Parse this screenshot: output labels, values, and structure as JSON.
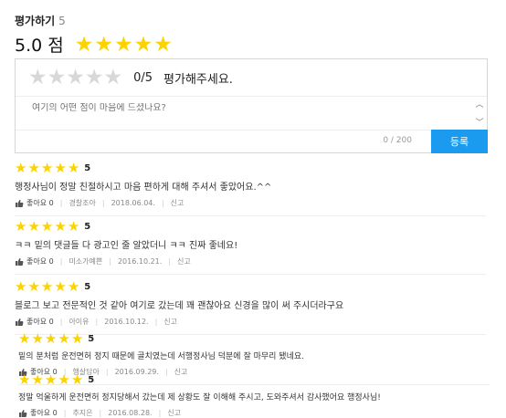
{
  "header": {
    "title": "평가하기",
    "count": "5"
  },
  "average": {
    "score": "5.0 점",
    "stars": 5
  },
  "form": {
    "rating_score": "0/5",
    "rating_prompt": "평가해주세요.",
    "input_placeholder": "여기의 어떤 점이 마음에 드셨나요?",
    "char_counter": "0 / 200",
    "submit_label": "등록"
  },
  "labels": {
    "like": "좋아요",
    "reply": "신고"
  },
  "reviews": [
    {
      "score": "5",
      "text": "행정사님이 정말 친절하시고 마음 편하게 대해 주셔서 좋았어요.^^",
      "likes": "0",
      "author": "경찰조아",
      "date": "2018.06.04."
    },
    {
      "score": "5",
      "text": "ㅋㅋ 밑의 댓글들 다 광고인 줄 알았더니 ㅋㅋ 진짜 좋네요!",
      "likes": "0",
      "author": "미소가예쁜",
      "date": "2016.10.21."
    },
    {
      "score": "5",
      "text": "블로그 보고 전문적인 것 같아 여기로 갔는데 꽤 괜찮아요 신경을 많이 써 주시더라구요",
      "likes": "0",
      "author": "아이유",
      "date": "2016.10.12."
    },
    {
      "score": "5",
      "text": "밑의 분처럼 운전면허 정지 때문에 골치였는데 서행정사님 덕분에 잘 마무리 됐네요.",
      "likes": "0",
      "author": "행살담아",
      "date": "2016.09.29."
    },
    {
      "score": "5",
      "text": "정말 억울하게 운전면허 정지당해서 갔는데 제 상황도 잘 이해해 주시고, 도와주셔서 감사했어요 행정사님!",
      "likes": "0",
      "author": "추지은",
      "date": "2016.08.28."
    }
  ],
  "colors": {
    "star_filled": "#fcd200",
    "star_empty": "#d8d8d8",
    "accent": "#1a9bf0"
  }
}
